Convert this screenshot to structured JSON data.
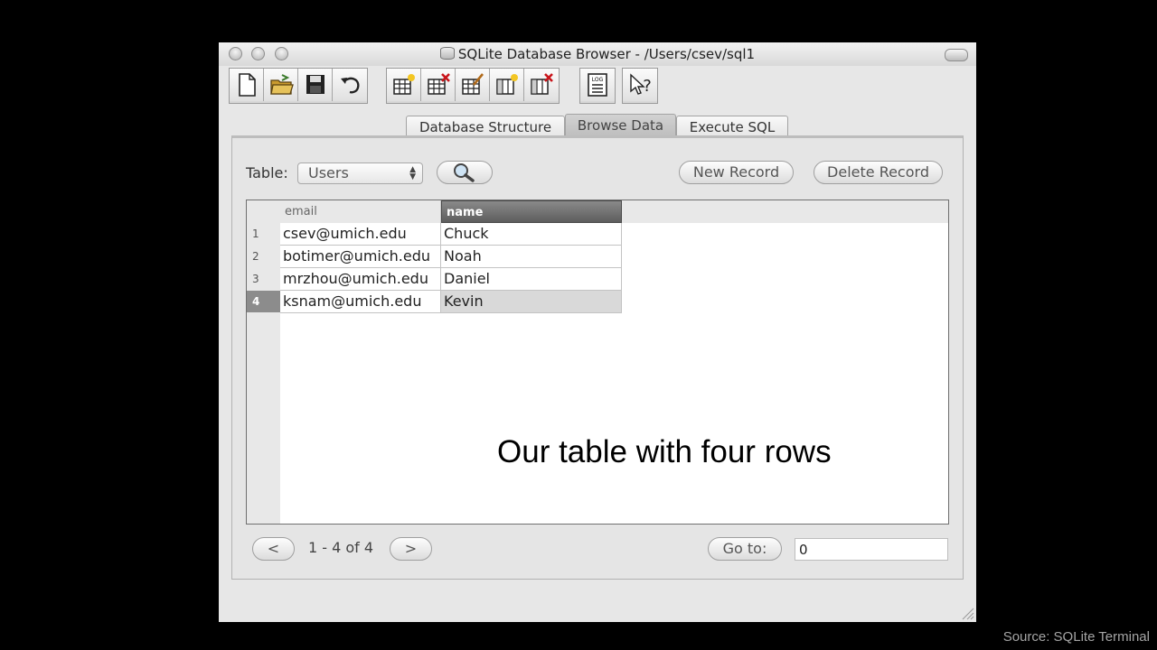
{
  "window": {
    "title": "SQLite Database Browser - /Users/csev/sql1"
  },
  "toolbar": {
    "icons": [
      "new-file-icon",
      "open-folder-icon",
      "save-icon",
      "undo-icon",
      "create-table-icon",
      "delete-table-icon",
      "modify-table-icon",
      "create-index-icon",
      "delete-index-icon",
      "log-icon",
      "whats-this-icon"
    ],
    "log_label": "LOG",
    "help_label": "?"
  },
  "tabs": [
    {
      "label": "Database Structure",
      "active": false
    },
    {
      "label": "Browse Data",
      "active": true
    },
    {
      "label": "Execute SQL",
      "active": false
    }
  ],
  "browse": {
    "table_label": "Table:",
    "table_value": "Users",
    "new_record": "New Record",
    "delete_record": "Delete Record"
  },
  "grid": {
    "columns": [
      "email",
      "name"
    ],
    "selected_column": "name",
    "rows": [
      {
        "num": "1",
        "email": "csev@umich.edu",
        "name": "Chuck"
      },
      {
        "num": "2",
        "email": "botimer@umich.edu",
        "name": "Noah"
      },
      {
        "num": "3",
        "email": "mrzhou@umich.edu",
        "name": "Daniel"
      },
      {
        "num": "4",
        "email": "ksnam@umich.edu",
        "name": "Kevin"
      }
    ],
    "selected_row": "4"
  },
  "caption": "Our table with four rows",
  "pager": {
    "prev": "<",
    "range": "1 - 4 of 4",
    "next": ">",
    "goto_label": "Go to:",
    "goto_value": "0"
  },
  "source": "Source: SQLite Terminal"
}
